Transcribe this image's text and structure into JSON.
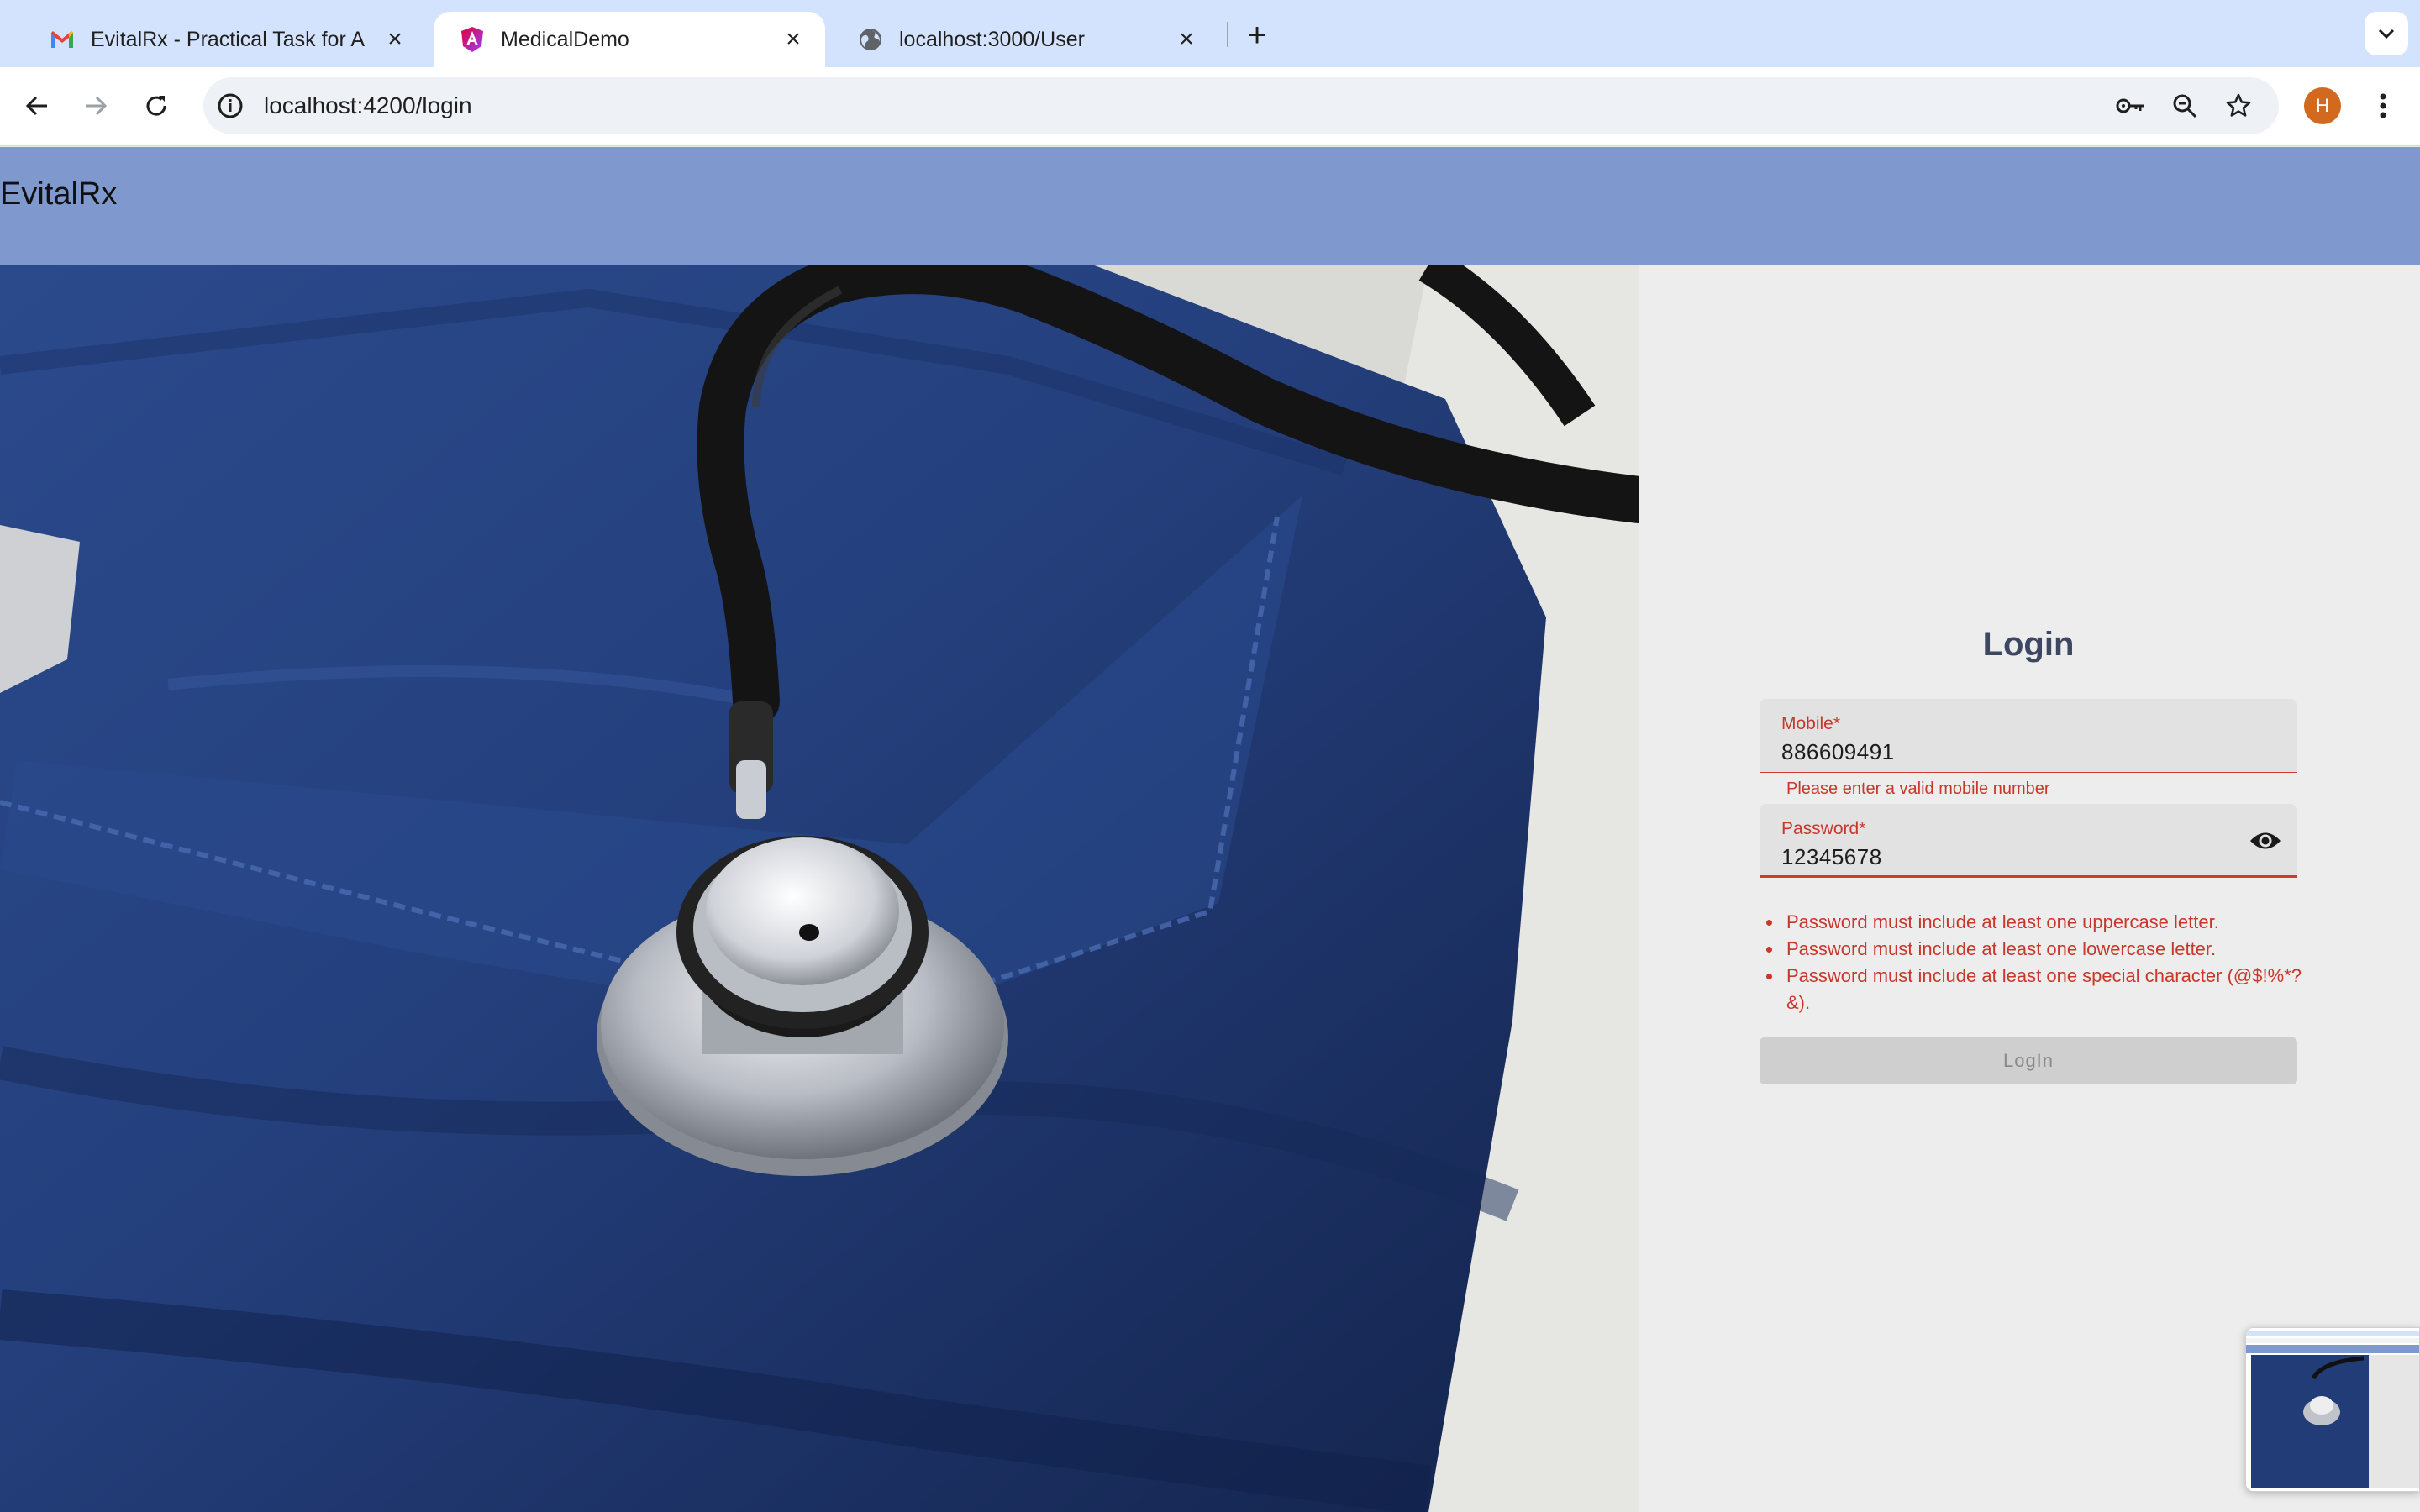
{
  "browser": {
    "tabs": [
      {
        "title": "EvitalRx - Practical Task for A",
        "icon": "gmail-icon",
        "active": false
      },
      {
        "title": "MedicalDemo",
        "icon": "angular-icon",
        "active": true
      },
      {
        "title": "localhost:3000/User",
        "icon": "globe-icon",
        "active": false
      }
    ],
    "new_tab_label": "+",
    "address": "localhost:4200/login",
    "profile_initial": "H",
    "colors": {
      "tabstrip": "#d3e3fd",
      "avatar": "#d2691e"
    }
  },
  "app": {
    "brand": "EvitalRx",
    "header_color": "#7f99cf"
  },
  "login": {
    "title": "Login",
    "mobile": {
      "label": "Mobile*",
      "value": "886609491",
      "hint": "Please enter a valid mobile number"
    },
    "password": {
      "label": "Password*",
      "value": "12345678",
      "toggle_icon": "eye-icon"
    },
    "errors": [
      "Password must include at least one uppercase letter.",
      "Password must include at least one lowercase letter.",
      "Password must include at least one special character (@$!%*?&)."
    ],
    "button_label": "LogIn",
    "error_color": "#c8372a"
  }
}
